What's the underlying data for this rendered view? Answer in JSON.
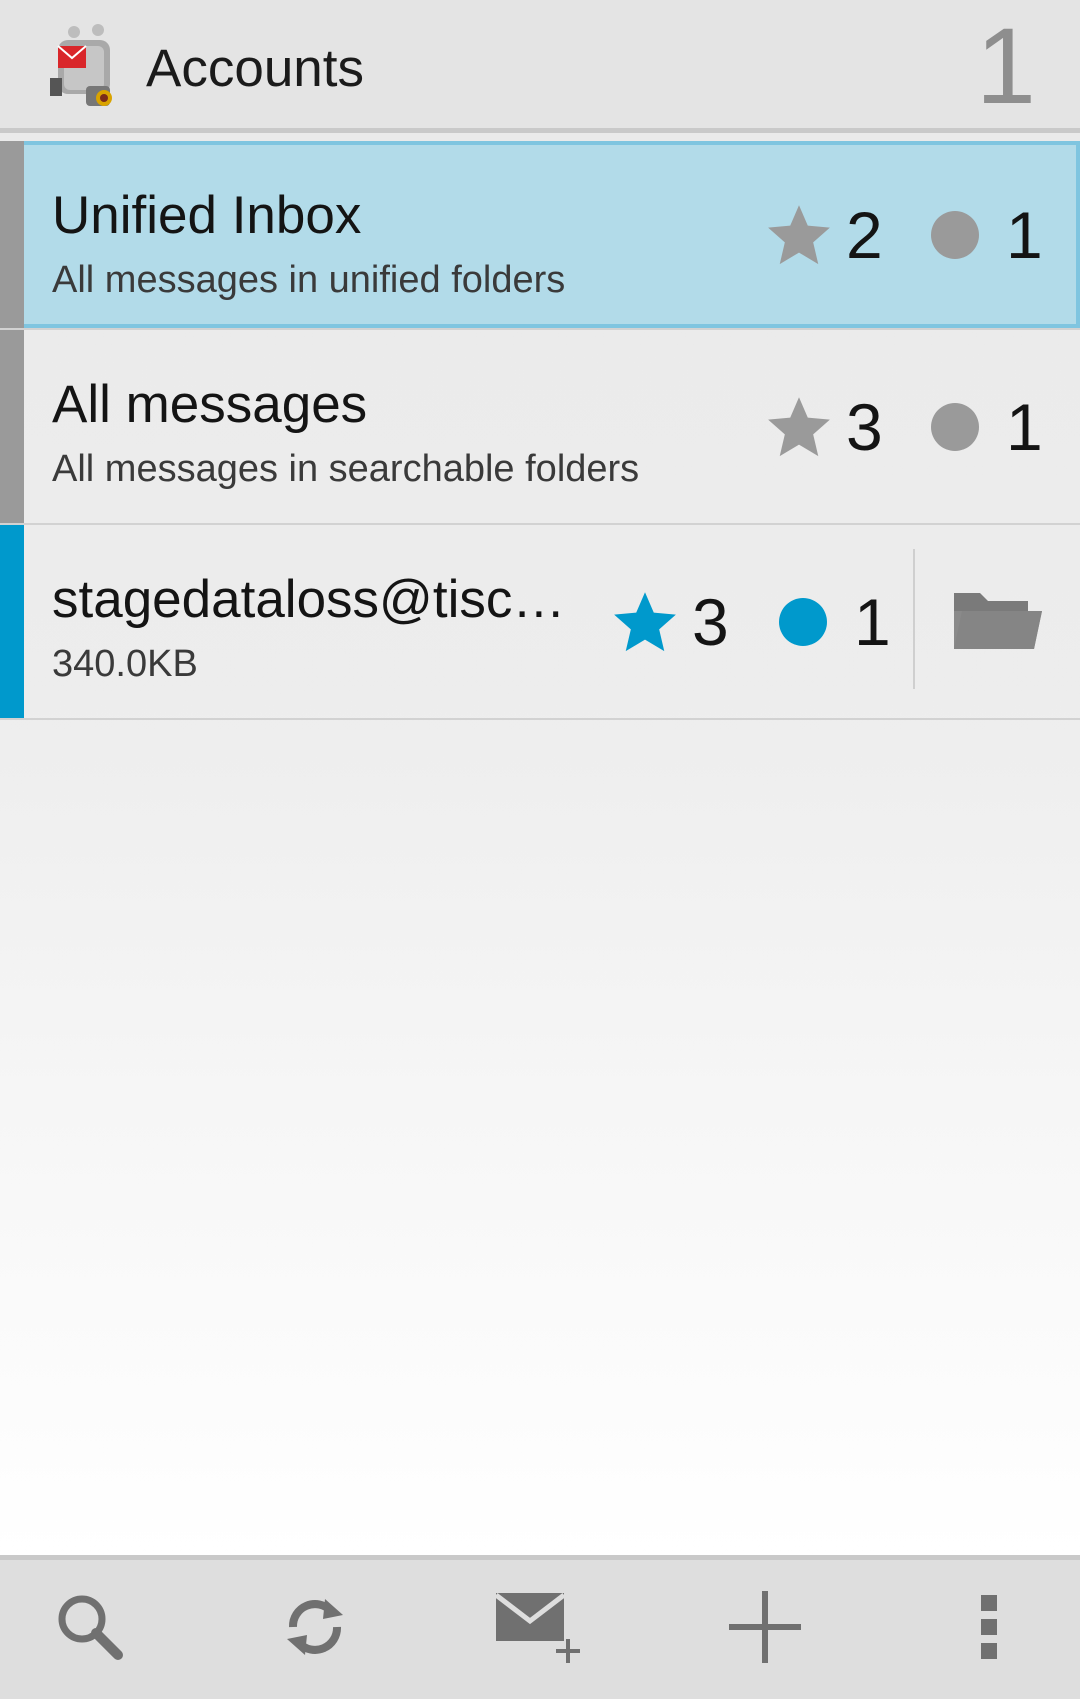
{
  "actionbar": {
    "title": "Accounts",
    "unread_count": "1",
    "app_icon": "k9-mail-dog-icon"
  },
  "accounts": [
    {
      "name": "Unified Inbox",
      "description": "All messages in unified folders",
      "flagged_count": "2",
      "unread_count": "1",
      "selected": true,
      "chip_color": "#9a9a9a",
      "icon_color": "#9a9a9a"
    },
    {
      "name": "All messages",
      "description": "All messages in searchable folders",
      "flagged_count": "3",
      "unread_count": "1",
      "selected": false,
      "chip_color": "#9a9a9a",
      "icon_color": "#9a9a9a"
    },
    {
      "name": "stagedataloss@tisc…",
      "description": "340.0KB",
      "flagged_count": "3",
      "unread_count": "1",
      "selected": false,
      "chip_color": "#0099cc",
      "icon_color": "#0099cc",
      "folder_icon": "folder-icon"
    }
  ],
  "bottombar": {
    "buttons": [
      "search-icon",
      "refresh-icon",
      "compose-icon",
      "add-icon",
      "overflow-menu-icon"
    ]
  },
  "colors": {
    "accent": "#0099cc",
    "selected_bg": "#b2dbe9"
  }
}
